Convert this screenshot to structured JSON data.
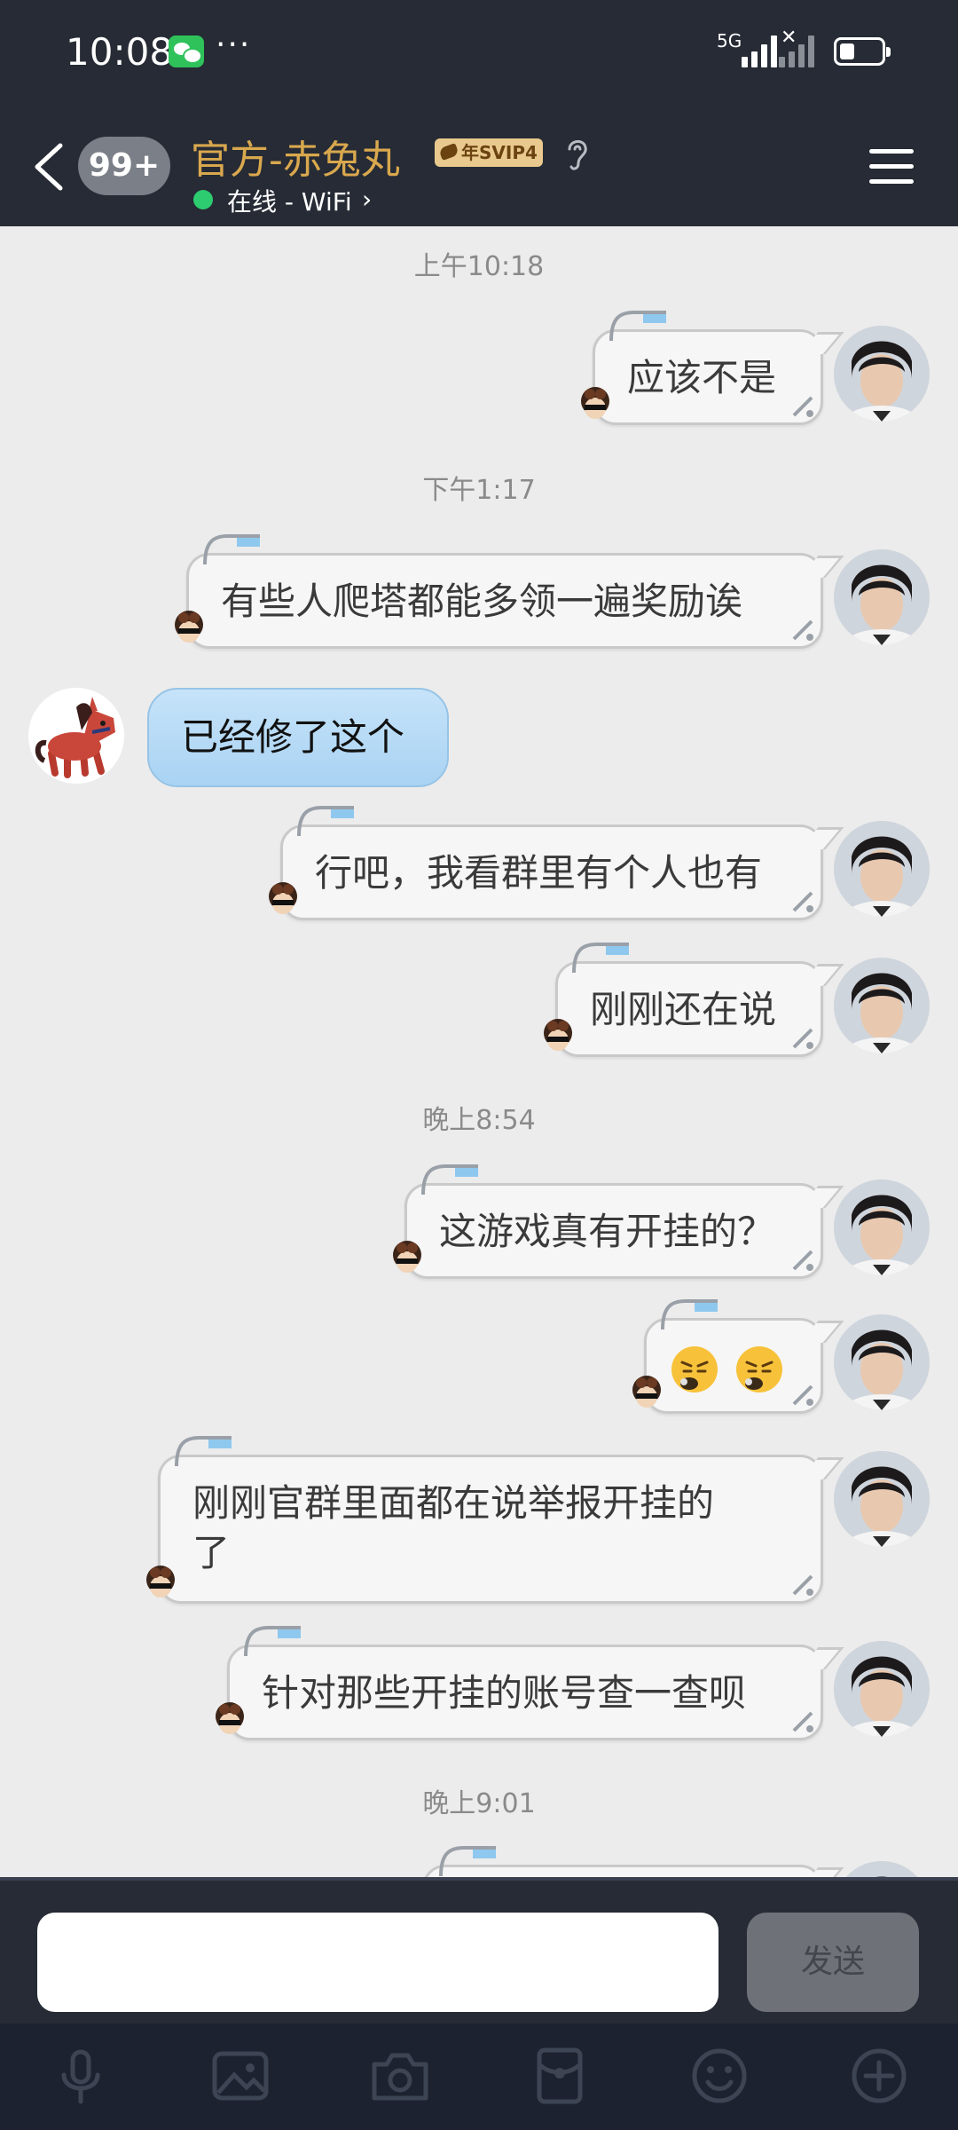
{
  "status_bar": {
    "time": "10:08",
    "more": "···",
    "network": "5G"
  },
  "header": {
    "back_icon": "chevron-left-icon",
    "unread_badge": "99+",
    "contact_name": "官方-赤兔丸",
    "vip_badge": "年SVIP4",
    "online_status": "在线 - WiFi",
    "menu_icon": "hamburger-menu-icon"
  },
  "messages": [
    {
      "type": "timestamp",
      "text": "上午10:18"
    },
    {
      "type": "out",
      "text": "应该不是"
    },
    {
      "type": "timestamp",
      "text": "下午1:17"
    },
    {
      "type": "out",
      "text": "有些人爬塔都能多领一遍奖励诶"
    },
    {
      "type": "in",
      "text": "已经修了这个"
    },
    {
      "type": "out",
      "text": "行吧，我看群里有个人也有"
    },
    {
      "type": "out",
      "text": "刚刚还在说"
    },
    {
      "type": "timestamp",
      "text": "晚上8:54"
    },
    {
      "type": "out",
      "text": "这游戏真有开挂的？"
    },
    {
      "type": "out",
      "emoji": [
        "huffing-face-emoji",
        "huffing-face-emoji"
      ]
    },
    {
      "type": "out",
      "text_line1": "刚刚官群里面都在说举报开挂的",
      "text_line2": "了"
    },
    {
      "type": "out",
      "text": "针对那些开挂的账号查一查呗"
    },
    {
      "type": "timestamp",
      "text": "晚上9:01"
    }
  ],
  "input": {
    "placeholder": "",
    "send_label": "发送"
  },
  "toolbar": [
    "microphone-icon",
    "image-icon",
    "camera-icon",
    "red-packet-icon",
    "emoji-icon",
    "plus-icon"
  ],
  "colors": {
    "header_bg": "#262b35",
    "title": "#d9a84e",
    "chat_bg": "#ececec",
    "online": "#2ecc71",
    "incoming_bubble": "#b8dbf5"
  }
}
